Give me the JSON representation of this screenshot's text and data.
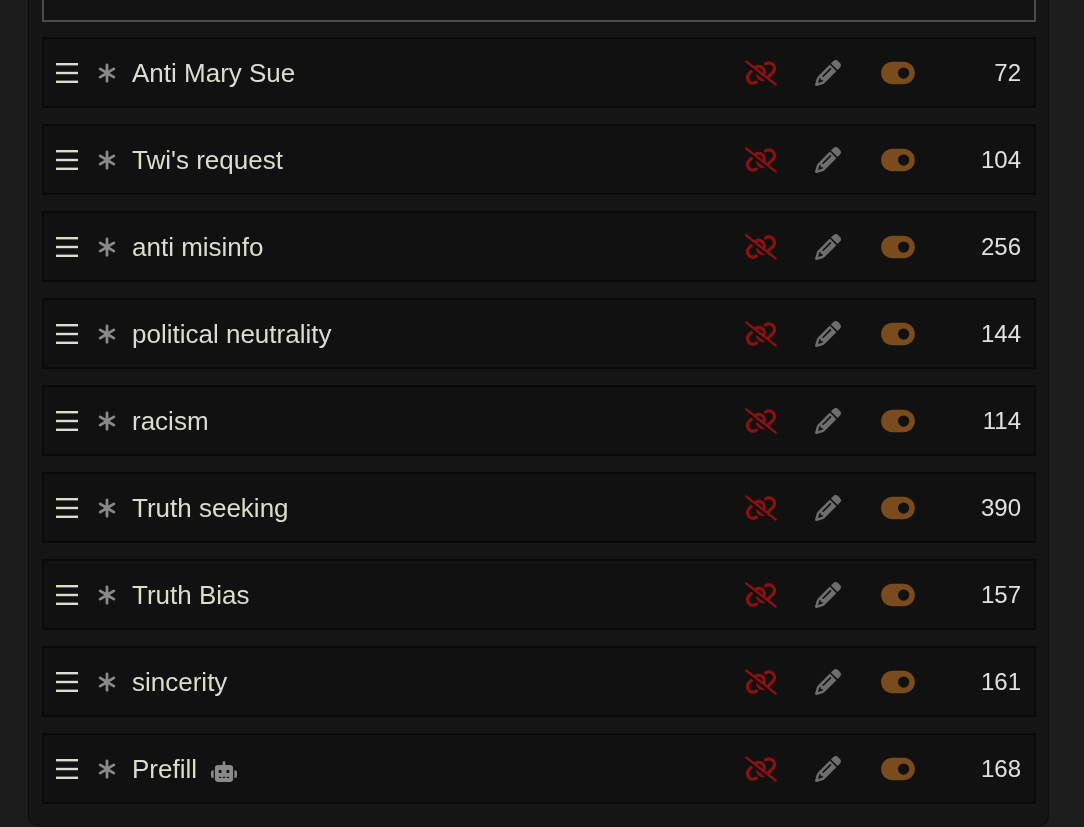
{
  "prompts": [
    {
      "name": "Anti Mary Sue",
      "enabled": true,
      "robot": false,
      "count": "72"
    },
    {
      "name": "Twi's request",
      "enabled": true,
      "robot": false,
      "count": "104"
    },
    {
      "name": "anti misinfo",
      "enabled": true,
      "robot": false,
      "count": "256"
    },
    {
      "name": "political neutrality",
      "enabled": true,
      "robot": false,
      "count": "144"
    },
    {
      "name": "racism",
      "enabled": true,
      "robot": false,
      "count": "114"
    },
    {
      "name": "Truth seeking",
      "enabled": true,
      "robot": false,
      "count": "390"
    },
    {
      "name": "Truth Bias",
      "enabled": true,
      "robot": false,
      "count": "157"
    },
    {
      "name": "sincerity",
      "enabled": true,
      "robot": false,
      "count": "161"
    },
    {
      "name": "Prefill",
      "enabled": true,
      "robot": true,
      "count": "168"
    }
  ]
}
